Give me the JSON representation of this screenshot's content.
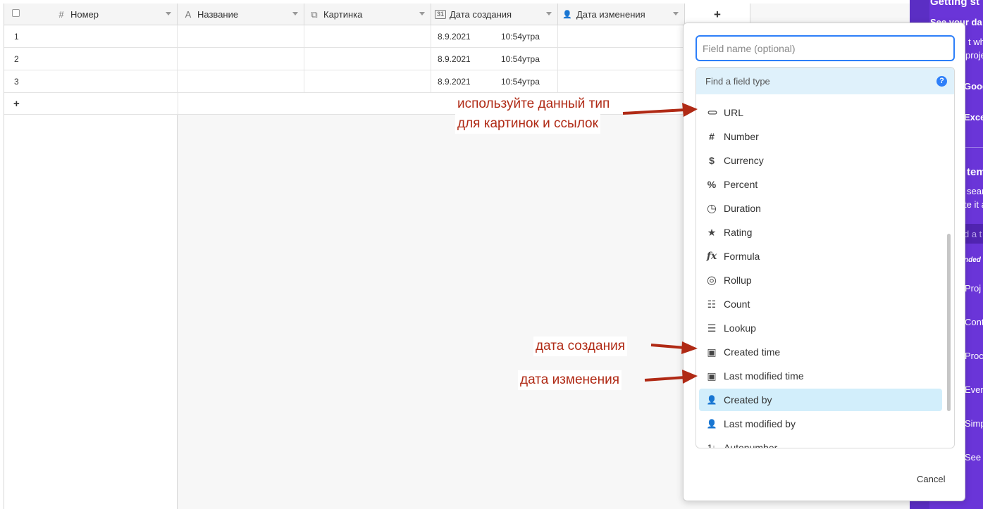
{
  "grid": {
    "columns": [
      {
        "icon": "#",
        "label": "Номер"
      },
      {
        "icon": "A",
        "label": "Название"
      },
      {
        "icon": "⧉",
        "label": "Картинка"
      },
      {
        "icon": "31",
        "label": "Дата создания"
      },
      {
        "icon": "👤",
        "label": "Дата изменения"
      }
    ],
    "add_column_label": "+",
    "rows": [
      {
        "num": "1",
        "date": "8.9.2021",
        "time": "10:54утра"
      },
      {
        "num": "2",
        "date": "8.9.2021",
        "time": "10:54утра"
      },
      {
        "num": "3",
        "date": "8.9.2021",
        "time": "10:54утра"
      }
    ],
    "add_row_label": "+"
  },
  "dialog": {
    "field_name_placeholder": "Field name (optional)",
    "find_placeholder": "Find a field type",
    "help_label": "?",
    "field_types": [
      {
        "icon": "link-icon",
        "glyph": "⊂⊃",
        "label": "URL",
        "selected": false
      },
      {
        "icon": "hash-icon",
        "glyph": "#",
        "label": "Number",
        "selected": false
      },
      {
        "icon": "dollar-icon",
        "glyph": "$",
        "label": "Currency",
        "selected": false
      },
      {
        "icon": "percent-icon",
        "glyph": "%",
        "label": "Percent",
        "selected": false
      },
      {
        "icon": "clock-icon",
        "glyph": "◷",
        "label": "Duration",
        "selected": false
      },
      {
        "icon": "star-icon",
        "glyph": "★",
        "label": "Rating",
        "selected": false
      },
      {
        "icon": "formula-icon",
        "glyph": "fx",
        "label": "Formula",
        "selected": false
      },
      {
        "icon": "spiral-icon",
        "glyph": "◎",
        "label": "Rollup",
        "selected": false
      },
      {
        "icon": "count-icon",
        "glyph": "☷",
        "label": "Count",
        "selected": false
      },
      {
        "icon": "lookup-icon",
        "glyph": "☰",
        "label": "Lookup",
        "selected": false
      },
      {
        "icon": "calendar-plus-icon",
        "glyph": "▣",
        "label": "Created time",
        "selected": false
      },
      {
        "icon": "calendar-edit-icon",
        "glyph": "▣",
        "label": "Last modified time",
        "selected": false
      },
      {
        "icon": "user-plus-icon",
        "glyph": "👤",
        "label": "Created by",
        "selected": true
      },
      {
        "icon": "user-edit-icon",
        "glyph": "👤",
        "label": "Last modified by",
        "selected": false
      },
      {
        "icon": "autonumber-icon",
        "glyph": "1↓",
        "label": "Autonumber",
        "selected": false
      }
    ],
    "cancel_label": "Cancel"
  },
  "annotations": {
    "url_note_line1": "используйте данный тип",
    "url_note_line2": "для картинок и ссылок",
    "created_note": "дата создания",
    "modified_note": "дата изменения"
  },
  "side_panel": {
    "texts": [
      "Getting st",
      "See your da",
      "t wh",
      "proje",
      "Goog",
      "Excel",
      "tem",
      "sear",
      "te it a",
      "d a t",
      "nded",
      "Proj",
      "Cont",
      "Proc",
      "Even",
      "Simp",
      "See"
    ]
  },
  "colors": {
    "accent": "#2d7ff9",
    "selected_bg": "#d2eefb",
    "annotation": "#b02a15",
    "purple": "#6a35d8"
  }
}
